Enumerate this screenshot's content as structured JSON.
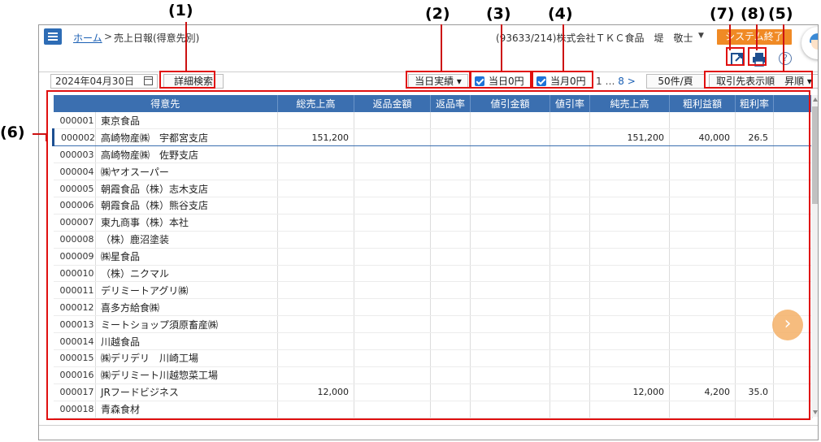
{
  "annotations": [
    "(1)",
    "(2)",
    "(3)",
    "(4)",
    "(7)",
    "(8)",
    "(5)",
    "(6)"
  ],
  "header": {
    "home_link": "ホーム",
    "sep": ">",
    "current": "売上日報(得意先別)",
    "user_info": "(93633/214)株式会社ＴＫＣ食品　堤　敬士",
    "user_dropdown": "▼",
    "exit_button": "システム終了",
    "help": "?"
  },
  "toolbar": {
    "date": "2024年04月30日",
    "detail_search": "詳細検索",
    "period_select": "当日実績 ▾",
    "zero_day": "当日0円",
    "zero_month": "当月0円",
    "pager_first": "1",
    "pager_ellipsis": "…",
    "pager_last": "8",
    "pager_next": ">",
    "page_size": "50件/頁",
    "sort_order": "取引先表示順　昇順 ▾"
  },
  "table": {
    "headers": [
      "得意先",
      "総売上高",
      "返品金額",
      "返品率",
      "値引金額",
      "値引率",
      "純売上高",
      "粗利益額",
      "粗利率"
    ],
    "rows": [
      [
        "000001",
        "東京食品",
        "",
        "",
        "",
        "",
        "",
        "",
        "",
        ""
      ],
      [
        "000002",
        "高崎物産㈱　宇都宮支店",
        "151,200",
        "",
        "",
        "",
        "",
        "151,200",
        "40,000",
        "26.5"
      ],
      [
        "000003",
        "高崎物産㈱　佐野支店",
        "",
        "",
        "",
        "",
        "",
        "",
        "",
        ""
      ],
      [
        "000004",
        "㈱ヤオスーパー",
        "",
        "",
        "",
        "",
        "",
        "",
        "",
        ""
      ],
      [
        "000005",
        "朝霞食品（株）志木支店",
        "",
        "",
        "",
        "",
        "",
        "",
        "",
        ""
      ],
      [
        "000006",
        "朝霞食品（株）熊谷支店",
        "",
        "",
        "",
        "",
        "",
        "",
        "",
        ""
      ],
      [
        "000007",
        "東九商事（株）本社",
        "",
        "",
        "",
        "",
        "",
        "",
        "",
        ""
      ],
      [
        "000008",
        "（株）鹿沼塗装",
        "",
        "",
        "",
        "",
        "",
        "",
        "",
        ""
      ],
      [
        "000009",
        "㈱星食品",
        "",
        "",
        "",
        "",
        "",
        "",
        "",
        ""
      ],
      [
        "000010",
        "（株）ニクマル",
        "",
        "",
        "",
        "",
        "",
        "",
        "",
        ""
      ],
      [
        "000011",
        "デリミートアグリ㈱",
        "",
        "",
        "",
        "",
        "",
        "",
        "",
        ""
      ],
      [
        "000012",
        "喜多方給食㈱",
        "",
        "",
        "",
        "",
        "",
        "",
        "",
        ""
      ],
      [
        "000013",
        "ミートショップ須原畜産㈱",
        "",
        "",
        "",
        "",
        "",
        "",
        "",
        ""
      ],
      [
        "000014",
        "川越食品",
        "",
        "",
        "",
        "",
        "",
        "",
        "",
        ""
      ],
      [
        "000015",
        "㈱デリデリ　川崎工場",
        "",
        "",
        "",
        "",
        "",
        "",
        "",
        ""
      ],
      [
        "000016",
        "㈱デリミート川越惣菜工場",
        "",
        "",
        "",
        "",
        "",
        "",
        "",
        ""
      ],
      [
        "000017",
        "JRフードビジネス",
        "12,000",
        "",
        "",
        "",
        "",
        "12,000",
        "4,200",
        "35.0"
      ],
      [
        "000018",
        "青森食材",
        "",
        "",
        "",
        "",
        "",
        "",
        "",
        ""
      ]
    ]
  },
  "next_fab": "›",
  "colors": {
    "header_blue": "#3b6fb0",
    "accent_orange": "#f08a25",
    "annotation_red": "#e01010"
  }
}
